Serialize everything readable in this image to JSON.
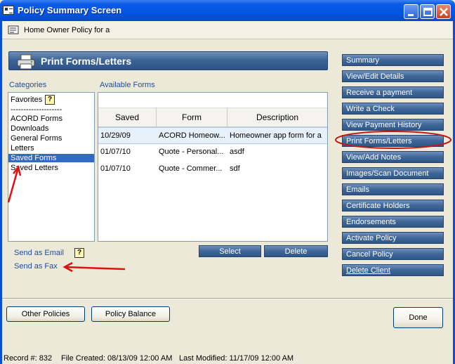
{
  "window": {
    "title": "Policy Summary Screen",
    "controls": [
      "minimize",
      "maximize",
      "close"
    ]
  },
  "header": {
    "policy_label": "Home Owner Policy for a"
  },
  "section": {
    "title": "Print Forms/Letters"
  },
  "categories": {
    "label": "Categories",
    "items": [
      {
        "label": "Favorites"
      },
      {
        "label": "--------------------"
      },
      {
        "label": "ACORD Forms"
      },
      {
        "label": "Downloads"
      },
      {
        "label": "General Forms"
      },
      {
        "label": "Letters"
      },
      {
        "label": "Saved Forms",
        "selected": true
      },
      {
        "label": "Saved Letters"
      }
    ]
  },
  "forms": {
    "label": "Available Forms",
    "columns": [
      "Saved",
      "Form",
      "Description"
    ],
    "rows": [
      {
        "saved": "10/29/09",
        "form": "ACORD Homeow...",
        "description": "Homeowner app form for a",
        "selected": true
      },
      {
        "saved": "01/07/10",
        "form": "Quote - Personal...",
        "description": "asdf"
      },
      {
        "saved": "01/07/10",
        "form": "Quote - Commer...",
        "description": "sdf"
      }
    ],
    "select_label": "Select",
    "delete_label": "Delete"
  },
  "send": {
    "email_label": "Send as Email",
    "fax_label": "Send as Fax"
  },
  "sidebar": {
    "items": [
      {
        "label": "Summary"
      },
      {
        "label": "View/Edit Details"
      },
      {
        "label": "Receive a payment"
      },
      {
        "label": "Write a Check"
      },
      {
        "label": "View Payment History"
      },
      {
        "label": "Print Forms/Letters",
        "highlighted": true
      },
      {
        "label": "View/Add Notes"
      },
      {
        "label": "Images/Scan Document"
      },
      {
        "label": "Emails"
      },
      {
        "label": "Certificate Holders"
      },
      {
        "label": "Endorsements"
      },
      {
        "label": "Activate Policy"
      },
      {
        "label": "Cancel Policy"
      },
      {
        "label": "Delete Client"
      }
    ]
  },
  "footer": {
    "other_policies_label": "Other Policies",
    "policy_balance_label": "Policy Balance",
    "done_label": "Done"
  },
  "status": {
    "record": "Record #: 832",
    "created": "File Created: 08/13/09 12:00 AM",
    "modified": "Last Modified: 11/17/09 12:00 AM"
  },
  "annotations": {
    "arrow_color": "#e01010",
    "ellipse_color": "#c01818"
  },
  "colors": {
    "button_blue": "#3e6698",
    "selection": "#316ac5",
    "label_blue": "#1f4e9b"
  }
}
